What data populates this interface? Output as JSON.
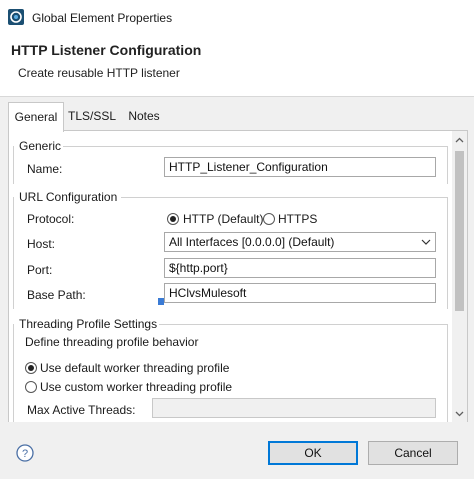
{
  "window": {
    "title": "Global Element Properties",
    "app_icon": "anypoint-studio-icon"
  },
  "banner": {
    "title": "HTTP Listener Configuration",
    "subtitle": "Create reusable HTTP listener"
  },
  "tabs": [
    {
      "label": "General",
      "active": true
    },
    {
      "label": "TLS/SSL",
      "active": false
    },
    {
      "label": "Notes",
      "active": false
    }
  ],
  "generic": {
    "legend": "Generic",
    "name_label": "Name:",
    "name_value": "HTTP_Listener_Configuration"
  },
  "url_config": {
    "legend": "URL Configuration",
    "protocol_label": "Protocol:",
    "protocol_options": [
      "HTTP (Default)",
      "HTTPS"
    ],
    "protocol_selected": "HTTP (Default)",
    "host_label": "Host:",
    "host_value": "All Interfaces [0.0.0.0] (Default)",
    "port_label": "Port:",
    "port_value": "${http.port}",
    "base_path_label": "Base Path:",
    "base_path_value": "HClvsMulesoft"
  },
  "threading": {
    "legend": "Threading Profile Settings",
    "description": "Define threading profile behavior",
    "options": [
      "Use default worker threading profile",
      "Use custom worker threading profile"
    ],
    "selected": "Use default worker threading profile",
    "max_active_label": "Max Active Threads:",
    "max_active_value": ""
  },
  "buttons": {
    "ok": "OK",
    "cancel": "Cancel"
  },
  "colors": {
    "default_button_border": "#0078d7",
    "window_bg": "#f0f0f0"
  }
}
